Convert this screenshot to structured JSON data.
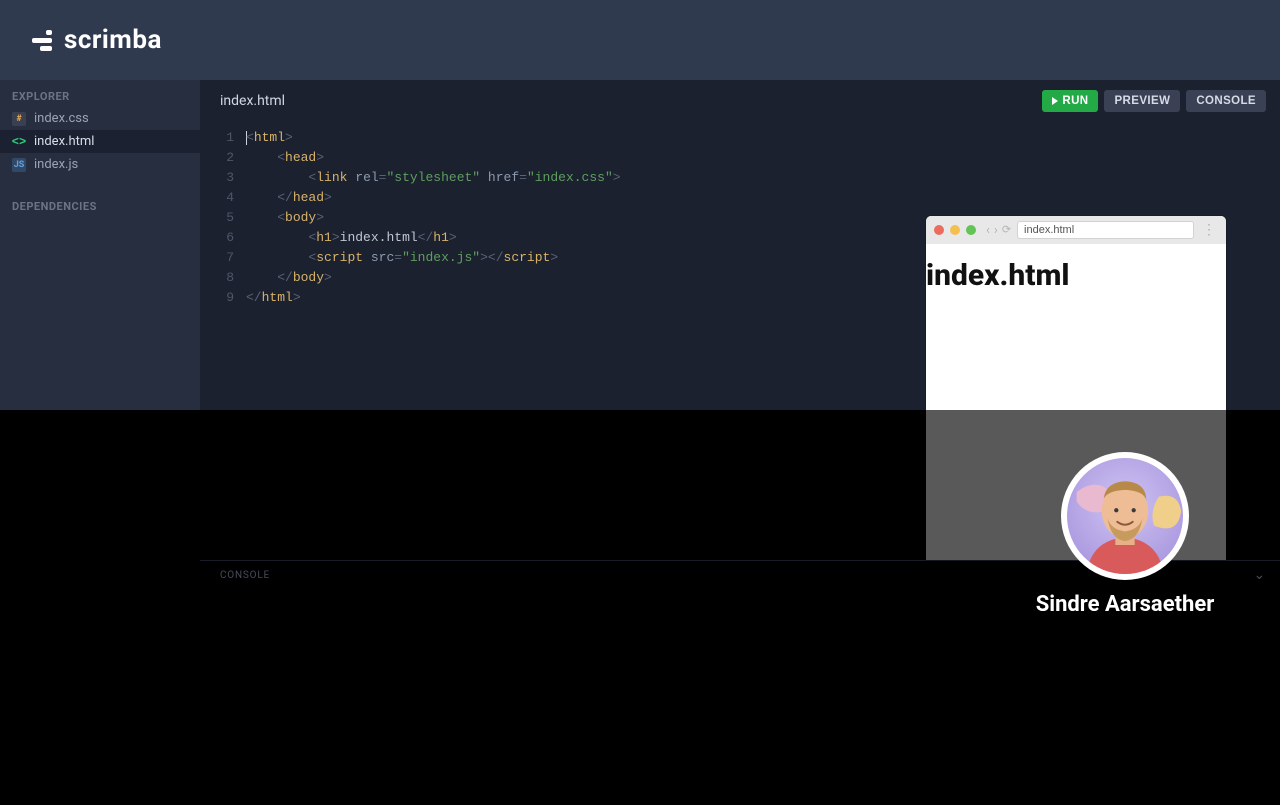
{
  "header": {
    "brand": "scrimba"
  },
  "sidebar": {
    "explorer_label": "EXPLORER",
    "dependencies_label": "DEPENDENCIES",
    "files": [
      {
        "name": "index.css",
        "icon": "#",
        "kind": "css",
        "active": false
      },
      {
        "name": "index.html",
        "icon": "<>",
        "kind": "html",
        "active": true
      },
      {
        "name": "index.js",
        "icon": "JS",
        "kind": "js",
        "active": false
      }
    ]
  },
  "editor": {
    "open_file": "index.html",
    "actions": {
      "run": "RUN",
      "preview": "PREVIEW",
      "console": "CONSOLE"
    },
    "code_lines": [
      {
        "n": 1,
        "indent": 0,
        "open": "html"
      },
      {
        "n": 2,
        "indent": 1,
        "open": "head"
      },
      {
        "n": 3,
        "indent": 2,
        "self": "link",
        "attrs": [
          [
            "rel",
            "stylesheet"
          ],
          [
            "href",
            "index.css"
          ]
        ]
      },
      {
        "n": 4,
        "indent": 1,
        "close": "head"
      },
      {
        "n": 5,
        "indent": 1,
        "open": "body"
      },
      {
        "n": 6,
        "indent": 2,
        "wrap": "h1",
        "text": "index.html"
      },
      {
        "n": 7,
        "indent": 2,
        "pair": "script",
        "attrs": [
          [
            "src",
            "index.js"
          ]
        ]
      },
      {
        "n": 8,
        "indent": 1,
        "close": "body"
      },
      {
        "n": 9,
        "indent": 0,
        "close": "html"
      }
    ]
  },
  "consolebar": {
    "label": "CONSOLE"
  },
  "preview": {
    "url": "index.html",
    "heading": "index.html"
  },
  "instructor": {
    "name": "Sindre Aarsaether"
  }
}
